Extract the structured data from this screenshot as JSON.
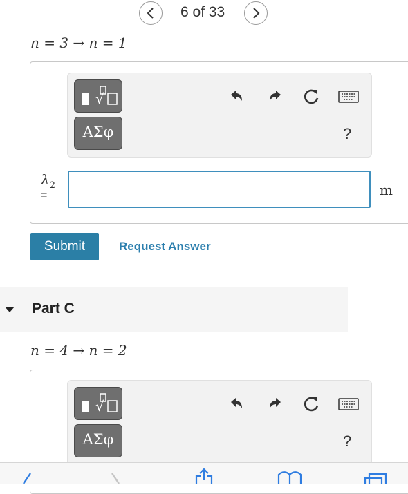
{
  "pager": {
    "text": "6 of 33"
  },
  "part_b": {
    "transition": "n = 3 → n = 1",
    "toolbar": {
      "templates_label": "templates",
      "greek_label": "ΑΣφ",
      "help_label": "?"
    },
    "answer_label": "λ",
    "answer_subscript": "2",
    "equals": "=",
    "answer_value": "",
    "unit": "m",
    "submit_label": "Submit",
    "request_answer_label": "Request Answer"
  },
  "part_c": {
    "title": "Part C",
    "transition": "n = 4 → n = 2",
    "toolbar": {
      "greek_label": "ΑΣφ",
      "help_label": "?"
    }
  },
  "icons": {
    "prev": "chevron-left-icon",
    "next": "chevron-right-icon",
    "undo": "undo-icon",
    "redo": "redo-icon",
    "reset": "reset-icon",
    "keyboard": "keyboard-icon",
    "collapse": "caret-down-icon",
    "browser_back": "back-icon",
    "share": "share-icon",
    "bookmarks": "book-icon",
    "tabs": "tabs-icon"
  },
  "colors": {
    "accent": "#2b7fa6",
    "link": "#2c7fae",
    "input_border": "#3f8fbd",
    "tool_button": "#6f6f6f"
  }
}
